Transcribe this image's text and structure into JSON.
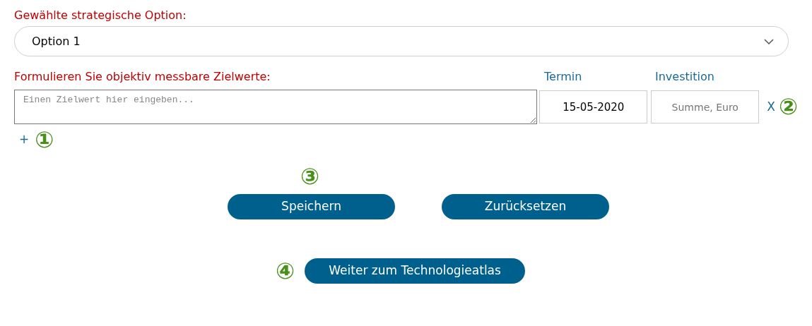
{
  "strategy": {
    "label": "Gewählte strategische Option:",
    "value": "Option 1"
  },
  "goals": {
    "label": "Formulieren Sie objektiv messbare Zielwerte:",
    "date_label": "Termin",
    "investment_label": "Investition",
    "rows": [
      {
        "placeholder": "Einen Zielwert hier eingeben...",
        "date": "15-05-2020",
        "investment_placeholder": "Summe, Euro",
        "remove": "X",
        "marker": "②"
      }
    ],
    "add": "+",
    "add_marker": "①"
  },
  "actions": {
    "marker": "③",
    "buttons": [
      "Speichern",
      "Zurücksetzen"
    ]
  },
  "next": {
    "marker": "④",
    "button": "Weiter zum Technologieatlas"
  }
}
